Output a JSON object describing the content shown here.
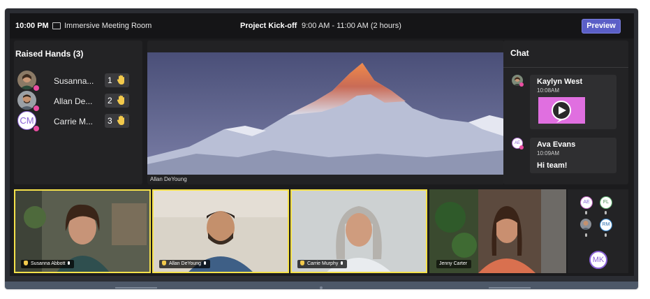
{
  "topbar": {
    "time": "10:00 PM",
    "room": "Immersive Meeting Room",
    "meeting_title": "Project Kick-off",
    "meeting_time": "9:00 AM - 11:00 AM (2 hours)",
    "preview_label": "Preview"
  },
  "raised_hands": {
    "title": "Raised Hands (3)",
    "people": [
      {
        "name": "Susanna...",
        "order": "1"
      },
      {
        "name": "Allan De...",
        "order": "2"
      },
      {
        "name": "Carrie M...",
        "order": "3",
        "initials": "CM"
      }
    ]
  },
  "main_video": {
    "caption": "Allan DeYoung"
  },
  "chat": {
    "title": "Chat",
    "messages": [
      {
        "sender": "Kaylyn West",
        "time": "10:08AM",
        "kind": "gif"
      },
      {
        "sender": "Ava Evans",
        "initials": "AE",
        "time": "10:09AM",
        "text": "Hi team!"
      }
    ]
  },
  "gallery": [
    {
      "name": "Susanna Abbott",
      "hand_raised": true,
      "active": true
    },
    {
      "name": "Allan DeYoung",
      "hand_raised": true,
      "active": true
    },
    {
      "name": "Carrie Murphy",
      "hand_raised": true,
      "active": true
    },
    {
      "name": "Jenny Carter",
      "hand_raised": false,
      "active": false
    }
  ],
  "roster": {
    "participants": [
      "AE",
      "FL",
      "",
      "RM"
    ],
    "self_initials": "MK"
  },
  "colors": {
    "accent": "#5b5fc7",
    "status_dot": "#e94da1",
    "hand": "#f2c94c",
    "active_tile": "#f5e14a",
    "self_avatar": "#8a62d6"
  }
}
